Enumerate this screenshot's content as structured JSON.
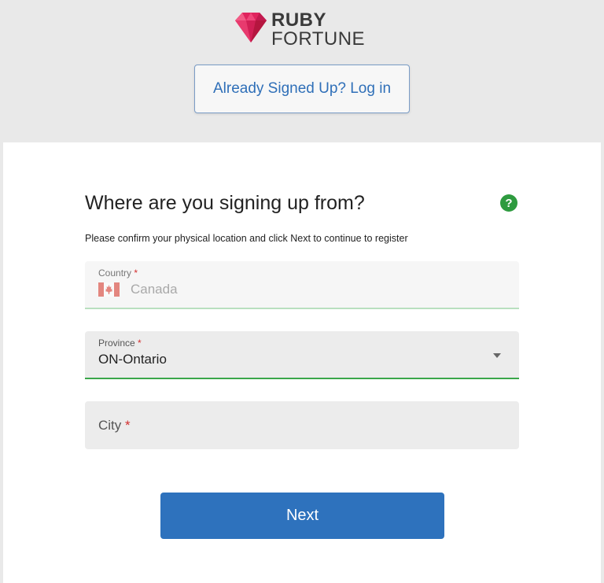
{
  "brand": {
    "line1": "RUBY",
    "line2": "FORTUNE",
    "gem_color": "#e0245e"
  },
  "header": {
    "login_label": "Already Signed Up? Log in"
  },
  "form": {
    "title": "Where are you signing up from?",
    "subtitle": "Please confirm your physical location and click Next to continue to register",
    "help_icon": "?",
    "required_mark": "*",
    "country": {
      "label": "Country",
      "value": "Canada",
      "flag": "canada-flag-icon"
    },
    "province": {
      "label": "Province",
      "value": "ON-Ontario"
    },
    "city": {
      "label": "City",
      "value": ""
    },
    "next_label": "Next"
  },
  "colors": {
    "accent_blue": "#2e72bd",
    "success_green": "#3aa64a",
    "required_red": "#d32f2f"
  }
}
